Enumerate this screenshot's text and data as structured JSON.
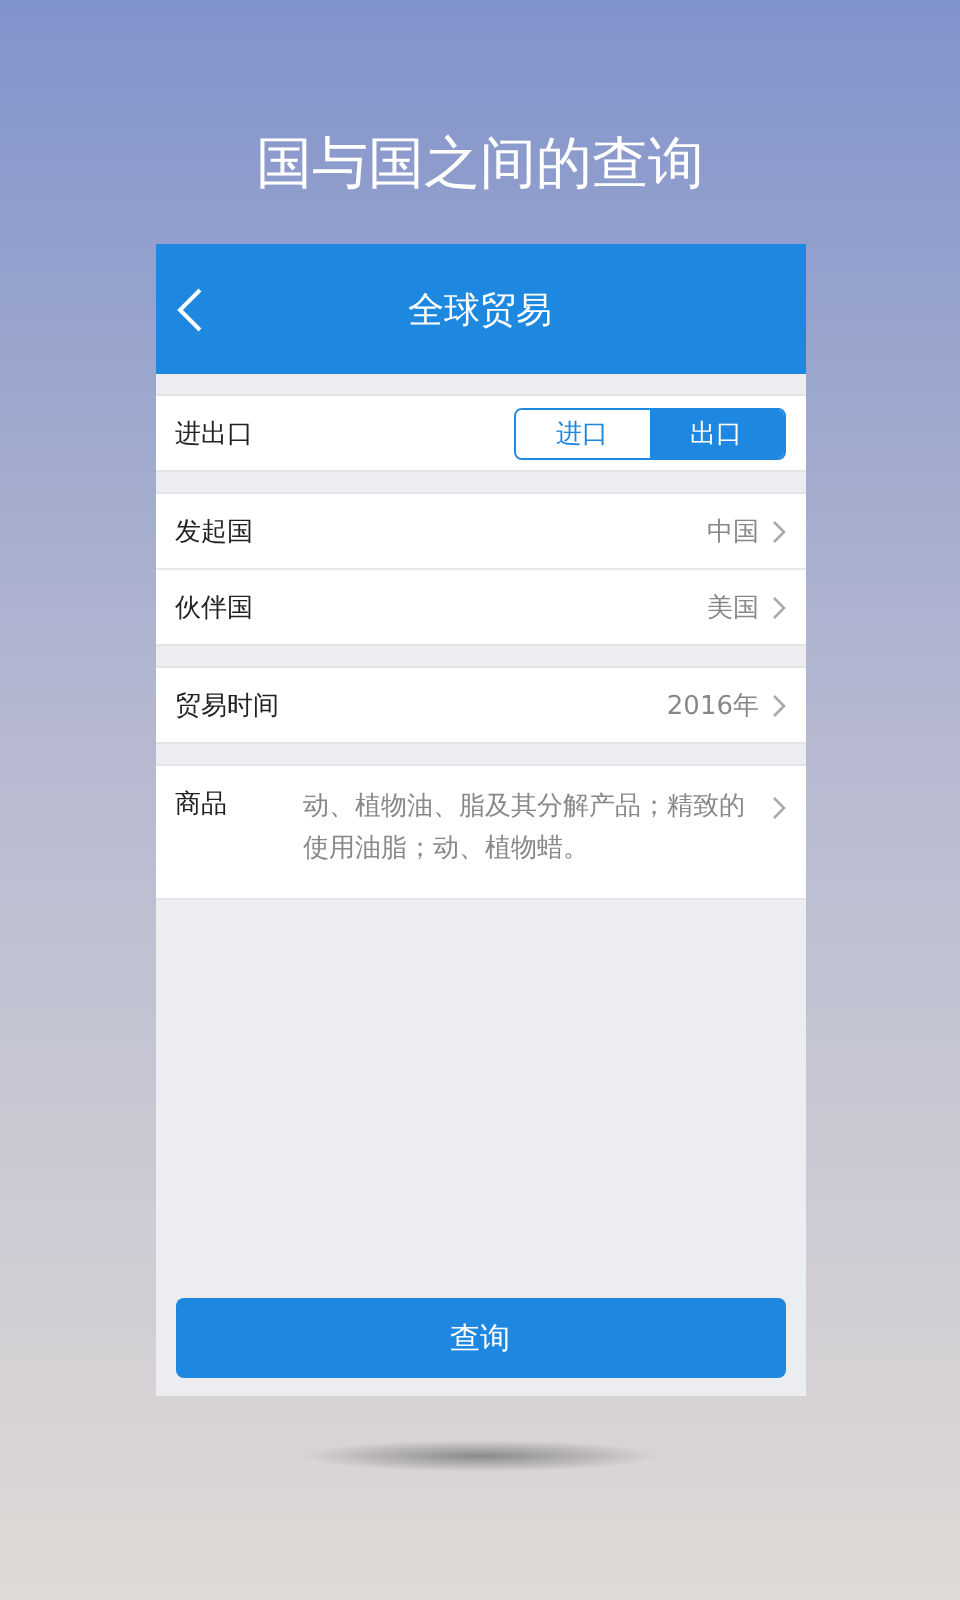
{
  "headline": "国与国之间的查询",
  "app": {
    "title": "全球贸易",
    "groups": [
      {
        "rows": [
          {
            "kind": "toggle",
            "label": "进出口",
            "options": [
              {
                "label": "进口",
                "selected": false
              },
              {
                "label": "出口",
                "selected": true
              }
            ]
          }
        ]
      },
      {
        "rows": [
          {
            "kind": "link",
            "label": "发起国",
            "value": "中国"
          },
          {
            "kind": "link",
            "label": "伙伴国",
            "value": "美国"
          }
        ]
      },
      {
        "rows": [
          {
            "kind": "link",
            "label": "贸易时间",
            "value": "2016年"
          }
        ]
      },
      {
        "rows": [
          {
            "kind": "multiline",
            "label": "商品",
            "value": "动、植物油、脂及其分解产品；精致的使用油脂；动、植物蜡。"
          }
        ]
      }
    ],
    "submit": "查询"
  }
}
